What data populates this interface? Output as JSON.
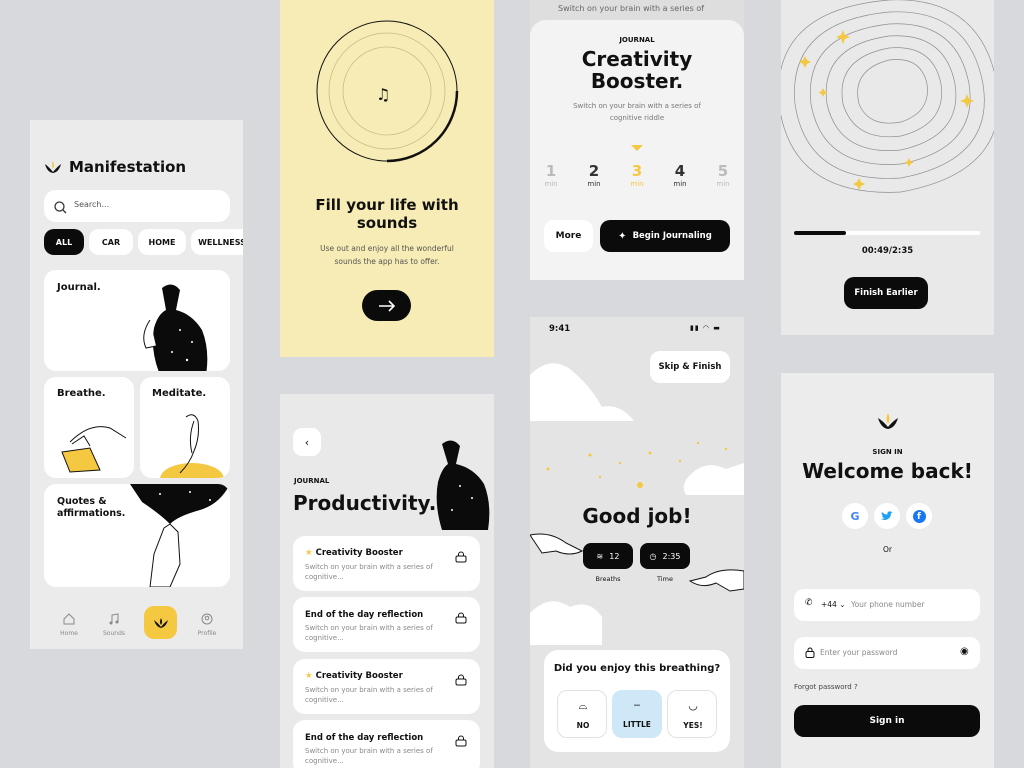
{
  "s1": {
    "app_title": "Manifestation",
    "search_placeholder": "Search...",
    "filters": [
      "ALL",
      "CAR",
      "HOME",
      "WELLNESS"
    ],
    "cards": {
      "journal": "Journal.",
      "breathe": "Breathe.",
      "meditate": "Meditate.",
      "quotes": "Quotes & affirmations."
    },
    "nav": {
      "home": "Home",
      "sounds": "Sounds",
      "profile": "Profile"
    }
  },
  "s2": {
    "title": "Fill your life with sounds",
    "subtitle": "Use out and enjoy all the wonderful sounds the app has to offer."
  },
  "s3": {
    "top_text": "Switch on your brain with a series of",
    "kicker": "JOURNAL",
    "title": "Creativity Booster.",
    "subtitle": "Switch on your brain with a series of cognitive riddle",
    "durations": [
      {
        "n": "1",
        "u": "min"
      },
      {
        "n": "2",
        "u": "min"
      },
      {
        "n": "3",
        "u": "min"
      },
      {
        "n": "4",
        "u": "min"
      },
      {
        "n": "5",
        "u": "min"
      }
    ],
    "more": "More",
    "begin": "Begin Journaling"
  },
  "s4": {
    "progress_fraction": 0.28,
    "time": "00:49/2:35",
    "finish": "Finish Earlier"
  },
  "s5": {
    "kicker": "JOURNAL",
    "title": "Productivity.",
    "items": [
      {
        "title": "Creativity Booster",
        "desc": "Switch on your brain with a series of cognitive...",
        "starred": true
      },
      {
        "title": "End of the day reflection",
        "desc": "Switch on your brain with a series of cognitive...",
        "starred": false
      },
      {
        "title": "Creativity Booster",
        "desc": "Switch on your brain with a series of cognitive...",
        "starred": true
      },
      {
        "title": "End of the day reflection",
        "desc": "Switch on your brain with a series of cognitive...",
        "starred": false
      }
    ]
  },
  "s6": {
    "clock": "9:41",
    "skip": "Skip & Finish",
    "heading": "Good job!",
    "breaths_value": "12",
    "breaths_label": "Breaths",
    "time_value": "2:35",
    "time_label": "Time",
    "question": "Did you enjoy this breathing?",
    "options": [
      "NO",
      "LITTLE",
      "YES!"
    ]
  },
  "s7": {
    "kicker": "SIGN IN",
    "title": "Welcome back!",
    "or": "Or",
    "country_code": "+44",
    "phone_placeholder": "Your phone number",
    "password_placeholder": "Enter your password",
    "forgot": "Forgot password ?",
    "signin": "Sign in"
  },
  "colors": {
    "accent": "#f5c842",
    "dark": "#0b0b0b",
    "pale_yellow": "#f7ecb5",
    "light_blue": "#cfe8f7"
  }
}
